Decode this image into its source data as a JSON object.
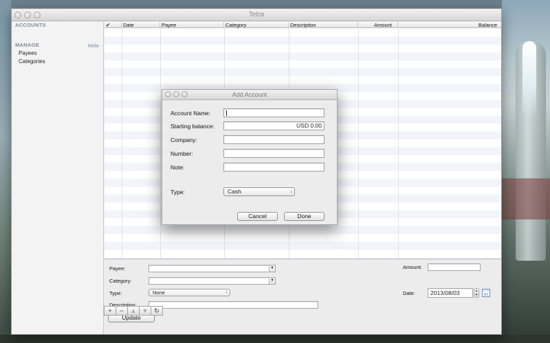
{
  "window": {
    "title": "Tetra"
  },
  "sidebar": {
    "accounts_header": "ACCOUNTS",
    "manage_header": "MANAGE",
    "hide_label": "Hide",
    "items": [
      {
        "label": "Payees"
      },
      {
        "label": "Categories"
      }
    ]
  },
  "table": {
    "columns": [
      "✔",
      "Date",
      "Payee",
      "Category",
      "Description",
      "Amount",
      "Balance"
    ],
    "rows": []
  },
  "form": {
    "payee_label": "Payee:",
    "payee_value": "",
    "category_label": "Category:",
    "category_value": "",
    "type_label": "Type:",
    "type_value": "None",
    "description_label": "Description:",
    "description_value": "",
    "amount_label": "Amount:",
    "amount_value": "",
    "date_label": "Date:",
    "date_value": "2013/08/03",
    "update_button": "Update"
  },
  "toolbar": {
    "add": "+",
    "remove": "−",
    "up": "▲",
    "down": "▼",
    "refresh": "↻"
  },
  "dialog": {
    "title": "Add Account",
    "account_name_label": "Account Name:",
    "account_name_value": "",
    "starting_balance_label": "Starting balance:",
    "starting_balance_value": "USD 0.00",
    "company_label": "Company:",
    "company_value": "",
    "number_label": "Number:",
    "number_value": "",
    "note_label": "Note:",
    "note_value": "",
    "type_label": "Type:",
    "type_value": "Cash",
    "cancel_button": "Cancel",
    "done_button": "Done"
  },
  "icons": {
    "popup_arrows": "↕",
    "combo_arrow": "▼",
    "stepper_up": "▲",
    "stepper_down": "▼"
  }
}
